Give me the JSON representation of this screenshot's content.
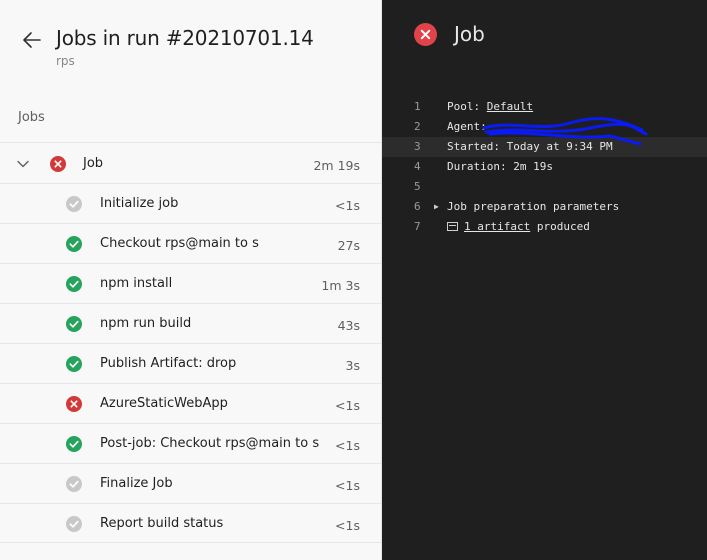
{
  "left": {
    "title": "Jobs in run #20210701.14",
    "subtitle": "rps",
    "section": "Jobs",
    "job": {
      "label": "Job",
      "duration": "2m 19s",
      "status": "failed"
    },
    "steps": [
      {
        "label": "Initialize job",
        "duration": "<1s",
        "status": "skipped"
      },
      {
        "label": "Checkout rps@main to s",
        "duration": "27s",
        "status": "succeeded"
      },
      {
        "label": "npm install",
        "duration": "1m 3s",
        "status": "succeeded"
      },
      {
        "label": "npm run build",
        "duration": "43s",
        "status": "succeeded"
      },
      {
        "label": "Publish Artifact: drop",
        "duration": "3s",
        "status": "succeeded"
      },
      {
        "label": "AzureStaticWebApp",
        "duration": "<1s",
        "status": "failed"
      },
      {
        "label": "Post-job: Checkout rps@main to s",
        "duration": "<1s",
        "status": "succeeded"
      },
      {
        "label": "Finalize Job",
        "duration": "<1s",
        "status": "skipped"
      },
      {
        "label": "Report build status",
        "duration": "<1s",
        "status": "skipped"
      }
    ]
  },
  "right": {
    "title": "Job",
    "log": [
      {
        "n": "1",
        "prefix": "Pool: ",
        "link": "Default",
        "suffix": ""
      },
      {
        "n": "2",
        "prefix": "Agent: ",
        "link": "",
        "suffix": ""
      },
      {
        "n": "3",
        "prefix": "Started: Today at 9:34 PM",
        "link": "",
        "suffix": ""
      },
      {
        "n": "4",
        "prefix": "Duration: 2m 19s",
        "link": "",
        "suffix": ""
      },
      {
        "n": "5",
        "prefix": "",
        "link": "",
        "suffix": ""
      },
      {
        "n": "6",
        "prefix": "Job preparation parameters",
        "link": "",
        "suffix": ""
      },
      {
        "n": "7",
        "prefix": "",
        "link": "1 artifact",
        "suffix": " produced"
      }
    ]
  },
  "colors": {
    "success": "#26a35c",
    "failure": "#d23a3a",
    "skipped": "#c8c8c8",
    "log_background": "#1f1f1f",
    "redaction": "#0a1aff"
  },
  "icons": {
    "back": "arrow-left-icon",
    "expand": "chevron-down-icon",
    "success": "check-circle-icon",
    "failure": "x-circle-icon",
    "skipped": "check-circle-gray-icon",
    "artifact": "artifact-icon",
    "disclosure": "triangle-right-icon"
  }
}
